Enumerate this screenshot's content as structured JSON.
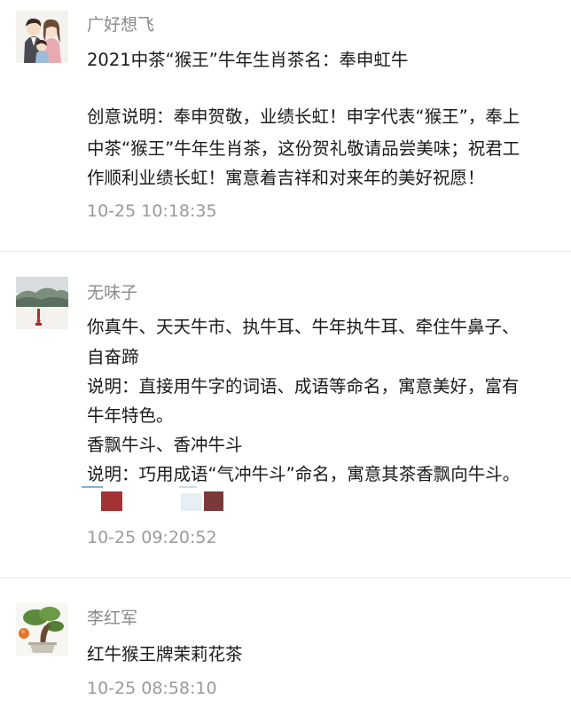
{
  "comments": [
    {
      "nickname": "广好想飞",
      "lines": [
        "2021中茶“猴王”牛年生肖茶名：奉申虹牛",
        "",
        "创意说明：奉申贺敬，业绩长虹！申字代表“猴王”，奉上",
        "中茶“猴王”牛年生肖茶，这份贺礼敬请品尝美味；祝君工",
        "作顺利业绩长虹！寓意着吉祥和对来年的美好祝愿！"
      ],
      "time": "10-25 10:18:35"
    },
    {
      "nickname": "无味子",
      "lines": [
        "你真牛、天天牛市、执牛耳、牛年执牛耳、牵住牛鼻子、",
        "自奋蹄",
        "说明：直接用牛字的词语、成语等命名，寓意美好，富有",
        "牛年特色。",
        "香飘牛斗、香冲牛斗",
        "说明：巧用成语“气冲牛斗”命名，寓意其茶香飘向牛斗。"
      ],
      "time": "10-25 09:20:52"
    },
    {
      "nickname": "李红军",
      "lines": [
        "红牛猴王牌茉莉花茶"
      ],
      "time": "10-25 08:58:10"
    }
  ]
}
